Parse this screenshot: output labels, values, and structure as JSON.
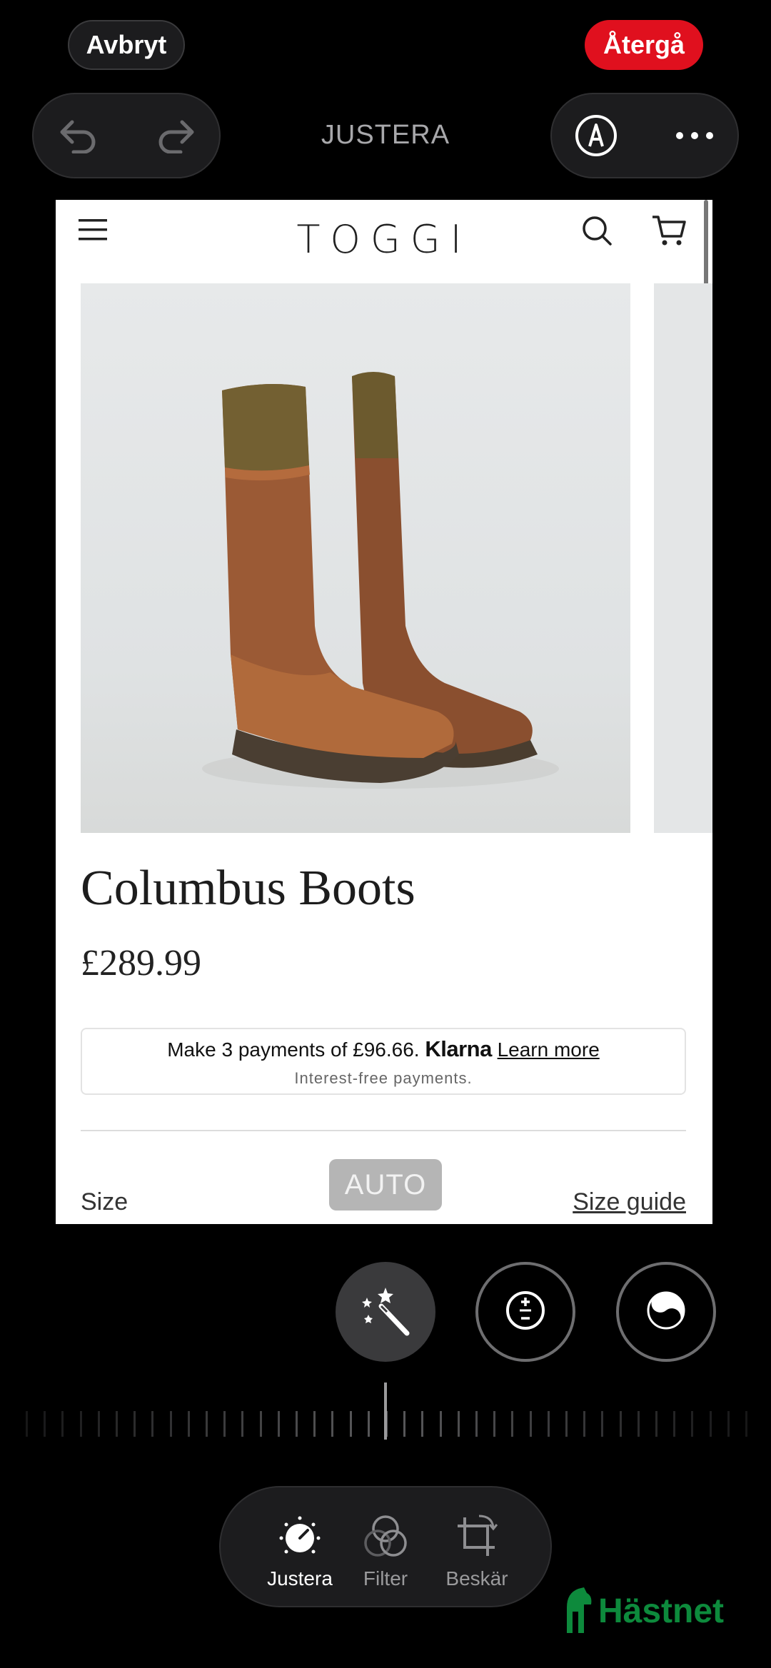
{
  "topbar": {
    "cancel_label": "Avbryt",
    "revert_label": "Återgå",
    "mode_title": "JUSTERA"
  },
  "screenshot": {
    "brand": "TOGGI",
    "product_title": "Columbus Boots",
    "product_price": "£289.99",
    "klarna": {
      "prefix": "Make 3 payments of £96.66.",
      "brand": "Klarna",
      "link": "Learn more",
      "subtext": "Interest-free payments."
    },
    "size_label": "Size",
    "size_guide": "Size guide",
    "auto_badge": "AUTO"
  },
  "tabs": [
    {
      "label": "Justera",
      "icon": "adjust-dial-icon",
      "active": true
    },
    {
      "label": "Filter",
      "icon": "filter-circles-icon",
      "active": false
    },
    {
      "label": "Beskär",
      "icon": "crop-rotate-icon",
      "active": false
    }
  ],
  "watermark": "Hästnet",
  "colors": {
    "accent_red": "#e0101e",
    "active_dot": "#ffd60a",
    "watermark_green": "#0d8a3c"
  }
}
